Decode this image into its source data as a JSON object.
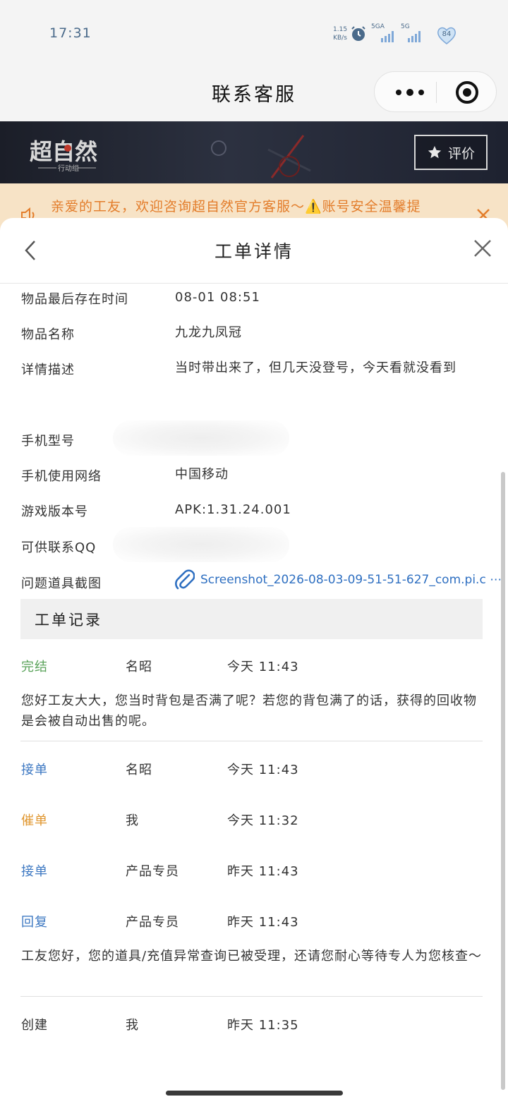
{
  "status_bar": {
    "time": "17:31",
    "speed_value": "1.15",
    "speed_unit": "KB/s",
    "net1": "5GA",
    "net2": "5G",
    "battery": "84"
  },
  "navbar": {
    "title": "联系客服"
  },
  "banner": {
    "rate_label": "评价"
  },
  "notice": {
    "text": "亲爱的工友，欢迎咨询超自然官方客服～⚠️账号安全温馨提"
  },
  "sheet": {
    "title": "工单详情",
    "fields": [
      {
        "label": "物品最后存在时间",
        "value": "08-01 08:51"
      },
      {
        "label": "物品名称",
        "value": "九龙九凤冠"
      },
      {
        "label": "详情描述",
        "value": "当时带出来了，但几天没登号，今天看就没看到"
      },
      {
        "label": "手机型号",
        "value": ""
      },
      {
        "label": "手机使用网络",
        "value": "中国移动"
      },
      {
        "label": "游戏版本号",
        "value": "APK:1.31.24.001"
      },
      {
        "label": "可供联系QQ",
        "value": ""
      },
      {
        "label": "问题道具截图",
        "value": "Screenshot_2026-08-03-09-51-51-627_com.pi.c ⋯"
      }
    ],
    "records_title": "工单记录",
    "records": [
      {
        "status": "完结",
        "who": "名昭",
        "when": "今天 11:43",
        "msg": "您好工友大大，您当时背包是否满了呢？若您的背包满了的话，获得的回收物是会被自动出售的呢。",
        "color": "#5aa35a"
      },
      {
        "status": "接单",
        "who": "名昭",
        "when": "今天 11:43",
        "msg": "",
        "color": "#3d78c2"
      },
      {
        "status": "催单",
        "who": "我",
        "when": "今天 11:32",
        "msg": "",
        "color": "#e0962e"
      },
      {
        "status": "接单",
        "who": "产品专员",
        "when": "昨天 11:43",
        "msg": "",
        "color": "#3d78c2"
      },
      {
        "status": "回复",
        "who": "产品专员",
        "when": "昨天 11:43",
        "msg": "工友您好，您的道具/充值异常查询已被受理，还请您耐心等待专人为您核查～",
        "color": "#3d78c2"
      },
      {
        "status": "创建",
        "who": "我",
        "when": "昨天 11:35",
        "msg": "",
        "color": "#333333"
      }
    ]
  }
}
